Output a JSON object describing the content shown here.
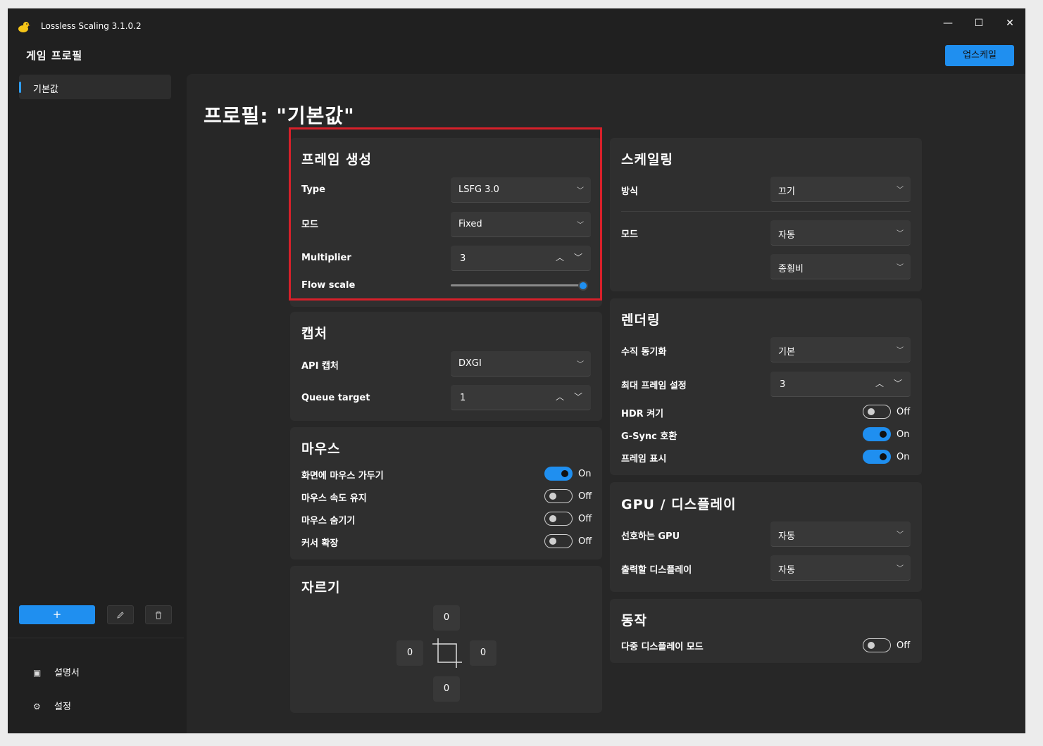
{
  "window": {
    "title": "Lossless Scaling 3.1.0.2"
  },
  "header": {
    "title": "게임 프로필",
    "upscale_button": "업스케일"
  },
  "sidebar": {
    "profiles": [
      {
        "label": "기본값"
      }
    ],
    "add_button": "+",
    "nav": [
      {
        "label": "설명서",
        "icon": "book-icon"
      },
      {
        "label": "설정",
        "icon": "gear-icon"
      }
    ]
  },
  "page": {
    "title": "프로필: \"기본값\""
  },
  "frame_gen": {
    "title": "프레임 생성",
    "type_label": "Type",
    "type_value": "LSFG 3.0",
    "mode_label": "모드",
    "mode_value": "Fixed",
    "multiplier_label": "Multiplier",
    "multiplier_value": "3",
    "flow_scale_label": "Flow scale",
    "flow_scale_value": 1.0
  },
  "capture": {
    "title": "캡처",
    "api_label": "API 캡처",
    "api_value": "DXGI",
    "queue_label": "Queue target",
    "queue_value": "1"
  },
  "mouse": {
    "title": "마우스",
    "toggles": [
      {
        "label": "화면에 마우스 가두기",
        "state": "On"
      },
      {
        "label": "마우스 속도 유지",
        "state": "Off"
      },
      {
        "label": "마우스 숨기기",
        "state": "Off"
      },
      {
        "label": "커서 확장",
        "state": "Off"
      }
    ]
  },
  "crop": {
    "title": "자르기",
    "top": "0",
    "left": "0",
    "right": "0",
    "bottom": "0"
  },
  "scaling": {
    "title": "스케일링",
    "method_label": "방식",
    "method_value": "끄기",
    "mode_label": "모드",
    "mode_value": "자동",
    "aspect_value": "종횡비"
  },
  "rendering": {
    "title": "렌더링",
    "vsync_label": "수직 동기화",
    "vsync_value": "기본",
    "max_frame_label": "최대 프레임 설정",
    "max_frame_value": "3",
    "toggles": [
      {
        "label": "HDR 켜기",
        "state": "Off"
      },
      {
        "label": "G-Sync 호환",
        "state": "On"
      },
      {
        "label": "프레임 표시",
        "state": "On"
      }
    ]
  },
  "gpu": {
    "title": "GPU / 디스플레이",
    "gpu_label": "선호하는 GPU",
    "gpu_value": "자동",
    "display_label": "출력할 디스플레이",
    "display_value": "자동"
  },
  "behavior": {
    "title": "동작",
    "toggles": [
      {
        "label": "다중 디스플레이 모드",
        "state": "Off"
      }
    ]
  },
  "colors": {
    "accent": "#1f8ff0",
    "highlight": "#d7202a",
    "background": "#202020",
    "card": "#2f2f2f"
  }
}
